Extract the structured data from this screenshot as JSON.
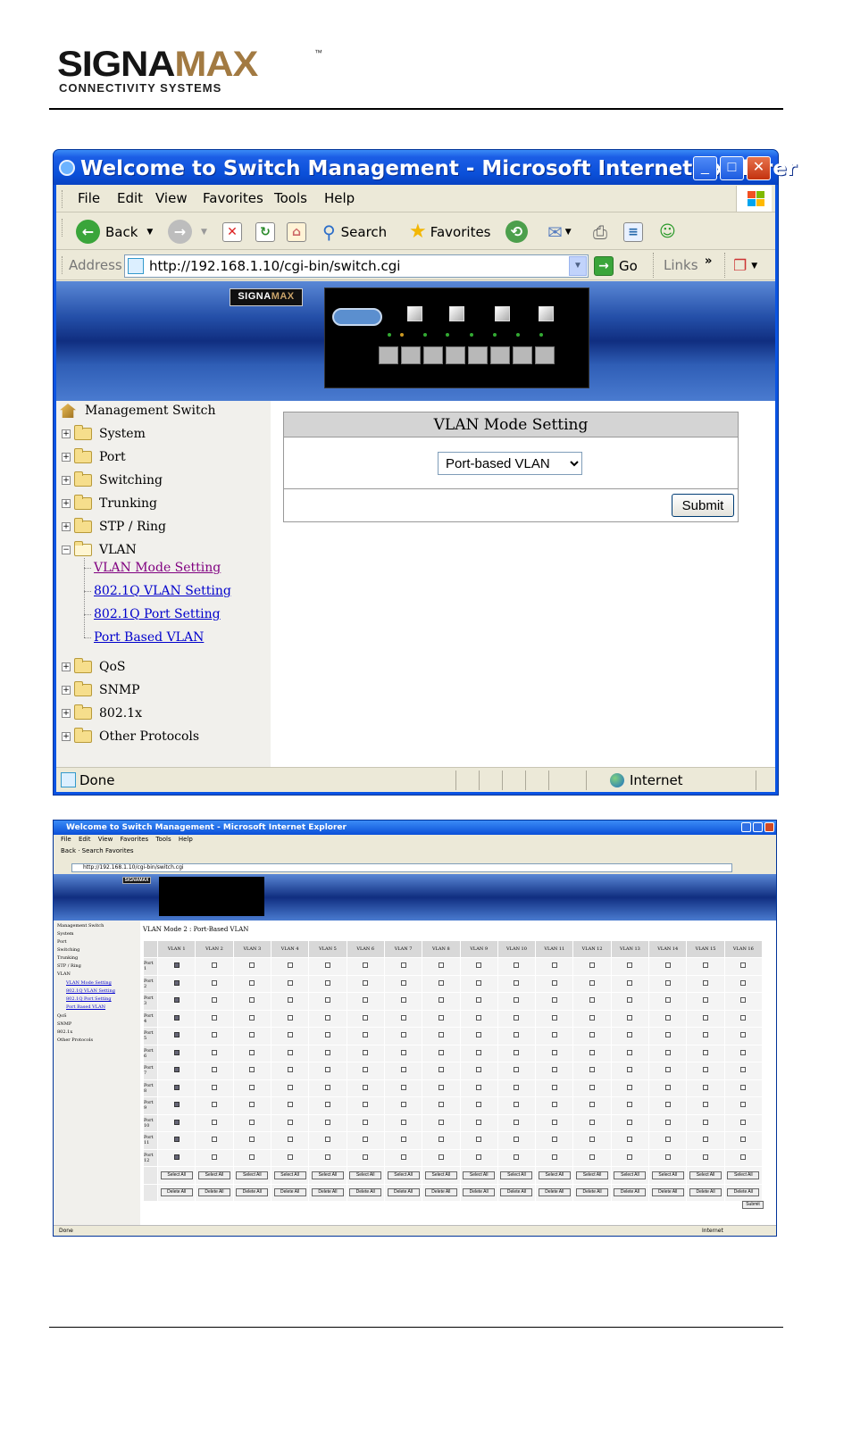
{
  "header": {
    "logo_word_a": "SIGNA",
    "logo_word_b": "MAX",
    "logo_tm": "™",
    "logo_tagline": "CONNECTIVITY SYSTEMS"
  },
  "window1": {
    "title": "Welcome to Switch Management - Microsoft Internet Explorer",
    "menu": [
      "File",
      "Edit",
      "View",
      "Favorites",
      "Tools",
      "Help"
    ],
    "toolbar": {
      "back": "Back",
      "search": "Search",
      "favorites": "Favorites"
    },
    "address": {
      "label": "Address",
      "url": "http://192.168.1.10/cgi-bin/switch.cgi",
      "go": "Go",
      "links": "Links",
      "chevron": "»"
    },
    "banner_logo_a": "SIGNA",
    "banner_logo_b": "MAX",
    "tree": {
      "root": "Management Switch",
      "folders": [
        "System",
        "Port",
        "Switching",
        "Trunking",
        "STP / Ring",
        "VLAN",
        "QoS",
        "SNMP",
        "802.1x",
        "Other Protocols"
      ],
      "vlan_links": [
        "VLAN Mode Setting",
        "802.1Q VLAN Setting",
        "802.1Q Port Setting",
        "Port Based VLAN"
      ]
    },
    "vlan_mode": {
      "heading": "VLAN Mode Setting",
      "selected": "Port-based VLAN",
      "submit": "Submit"
    },
    "status": {
      "text": "Done",
      "zone": "Internet"
    }
  },
  "window2": {
    "title": "Welcome to Switch Management - Microsoft Internet Explorer",
    "menu": "File Edit View Favorites Tools Help",
    "toolbar": "Back · Search Favorites",
    "url": "http://192.168.1.10/cgi-bin/switch.cgi",
    "banner_logo": "SIGNAMAX",
    "tree": {
      "root": "Management Switch",
      "items": [
        "System",
        "Port",
        "Switching",
        "Trunking",
        "STP / Ring",
        "VLAN"
      ],
      "links": [
        "VLAN Mode Setting",
        "802.1Q VLAN Setting",
        "802.1Q Port Setting",
        "Port Based VLAN"
      ],
      "items_after": [
        "QoS",
        "SNMP",
        "802.1x",
        "Other Protocols"
      ]
    },
    "table_title": "VLAN Mode 2 : Port-Based VLAN",
    "columns": [
      "VLAN 1",
      "VLAN 2",
      "VLAN 3",
      "VLAN 4",
      "VLAN 5",
      "VLAN 6",
      "VLAN 7",
      "VLAN 8",
      "VLAN 9",
      "VLAN 10",
      "VLAN 11",
      "VLAN 12",
      "VLAN 13",
      "VLAN 14",
      "VLAN 15",
      "VLAN 16"
    ],
    "rows": [
      "Port 1",
      "Port 2",
      "Port 3",
      "Port 4",
      "Port 5",
      "Port 6",
      "Port 7",
      "Port 8",
      "Port 9",
      "Port 10",
      "Port 11",
      "Port 12"
    ],
    "select_all": "Select All",
    "delete_all": "Delete All",
    "submit": "Submit",
    "status": "Done",
    "zone": "Internet"
  }
}
